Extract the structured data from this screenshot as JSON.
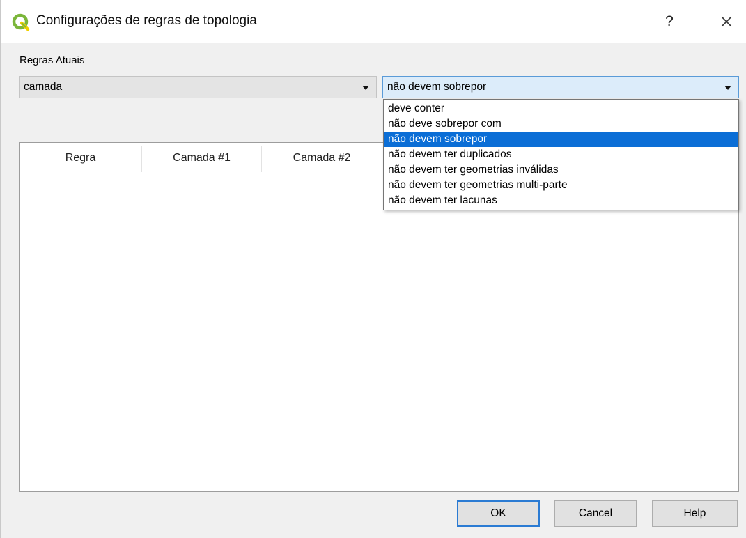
{
  "window": {
    "title": "Configurações de regras de topologia",
    "help_label": "?",
    "brand_color": "#7bb63a"
  },
  "current_rules": {
    "label": "Regras Atuais",
    "layer_combo_value": "camada",
    "rule_combo_value": "não devem sobrepor"
  },
  "rule_dropdown": {
    "options": [
      "deve conter",
      "não deve sobrepor com",
      "não devem sobrepor",
      "não devem ter duplicados",
      "não devem ter geometrias inválidas",
      "não devem ter geometrias multi-parte",
      "não devem ter lacunas"
    ],
    "selected": "não devem sobrepor",
    "selected_color": "#0b6ed6"
  },
  "table": {
    "columns": [
      "Regra",
      "Camada #1",
      "Camada #2"
    ],
    "rows": []
  },
  "buttons": {
    "ok": "OK",
    "cancel": "Cancel",
    "help": "Help"
  }
}
